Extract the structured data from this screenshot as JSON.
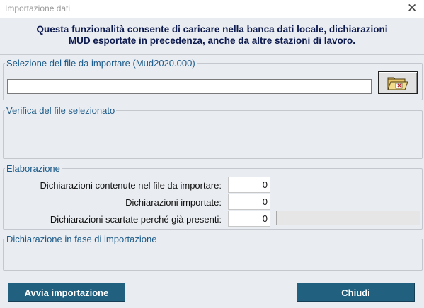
{
  "window": {
    "title": "Importazione dati",
    "close_glyph": "✕"
  },
  "header": {
    "line1": "Questa funzionalità consente di caricare nella banca dati locale, dichiarazioni",
    "line2": "MUD esportate in precedenza, anche da altre stazioni di lavoro."
  },
  "file_selection": {
    "legend": "Selezione del file da importare (Mud2020.000)",
    "path_value": "",
    "browse_icon": "folder-open-icon"
  },
  "verification": {
    "legend": "Verifica del file selezionato"
  },
  "processing": {
    "legend": "Elaborazione",
    "rows": [
      {
        "label": "Dichiarazioni contenute nel file da importare:",
        "value": "0"
      },
      {
        "label": "Dichiarazioni importate:",
        "value": "0"
      },
      {
        "label": "Dichiarazioni scartate perché già presenti:",
        "value": "0"
      }
    ],
    "progress_fraction": 0
  },
  "current": {
    "legend": "Dichiarazione in fase di importazione"
  },
  "buttons": {
    "start": "Avvia importazione",
    "close": "Chiudi"
  },
  "colors": {
    "button_bg": "#21607f",
    "legend_text": "#1d5b8a",
    "header_text": "#0d1a4e",
    "client_bg": "#e9ecf0"
  }
}
